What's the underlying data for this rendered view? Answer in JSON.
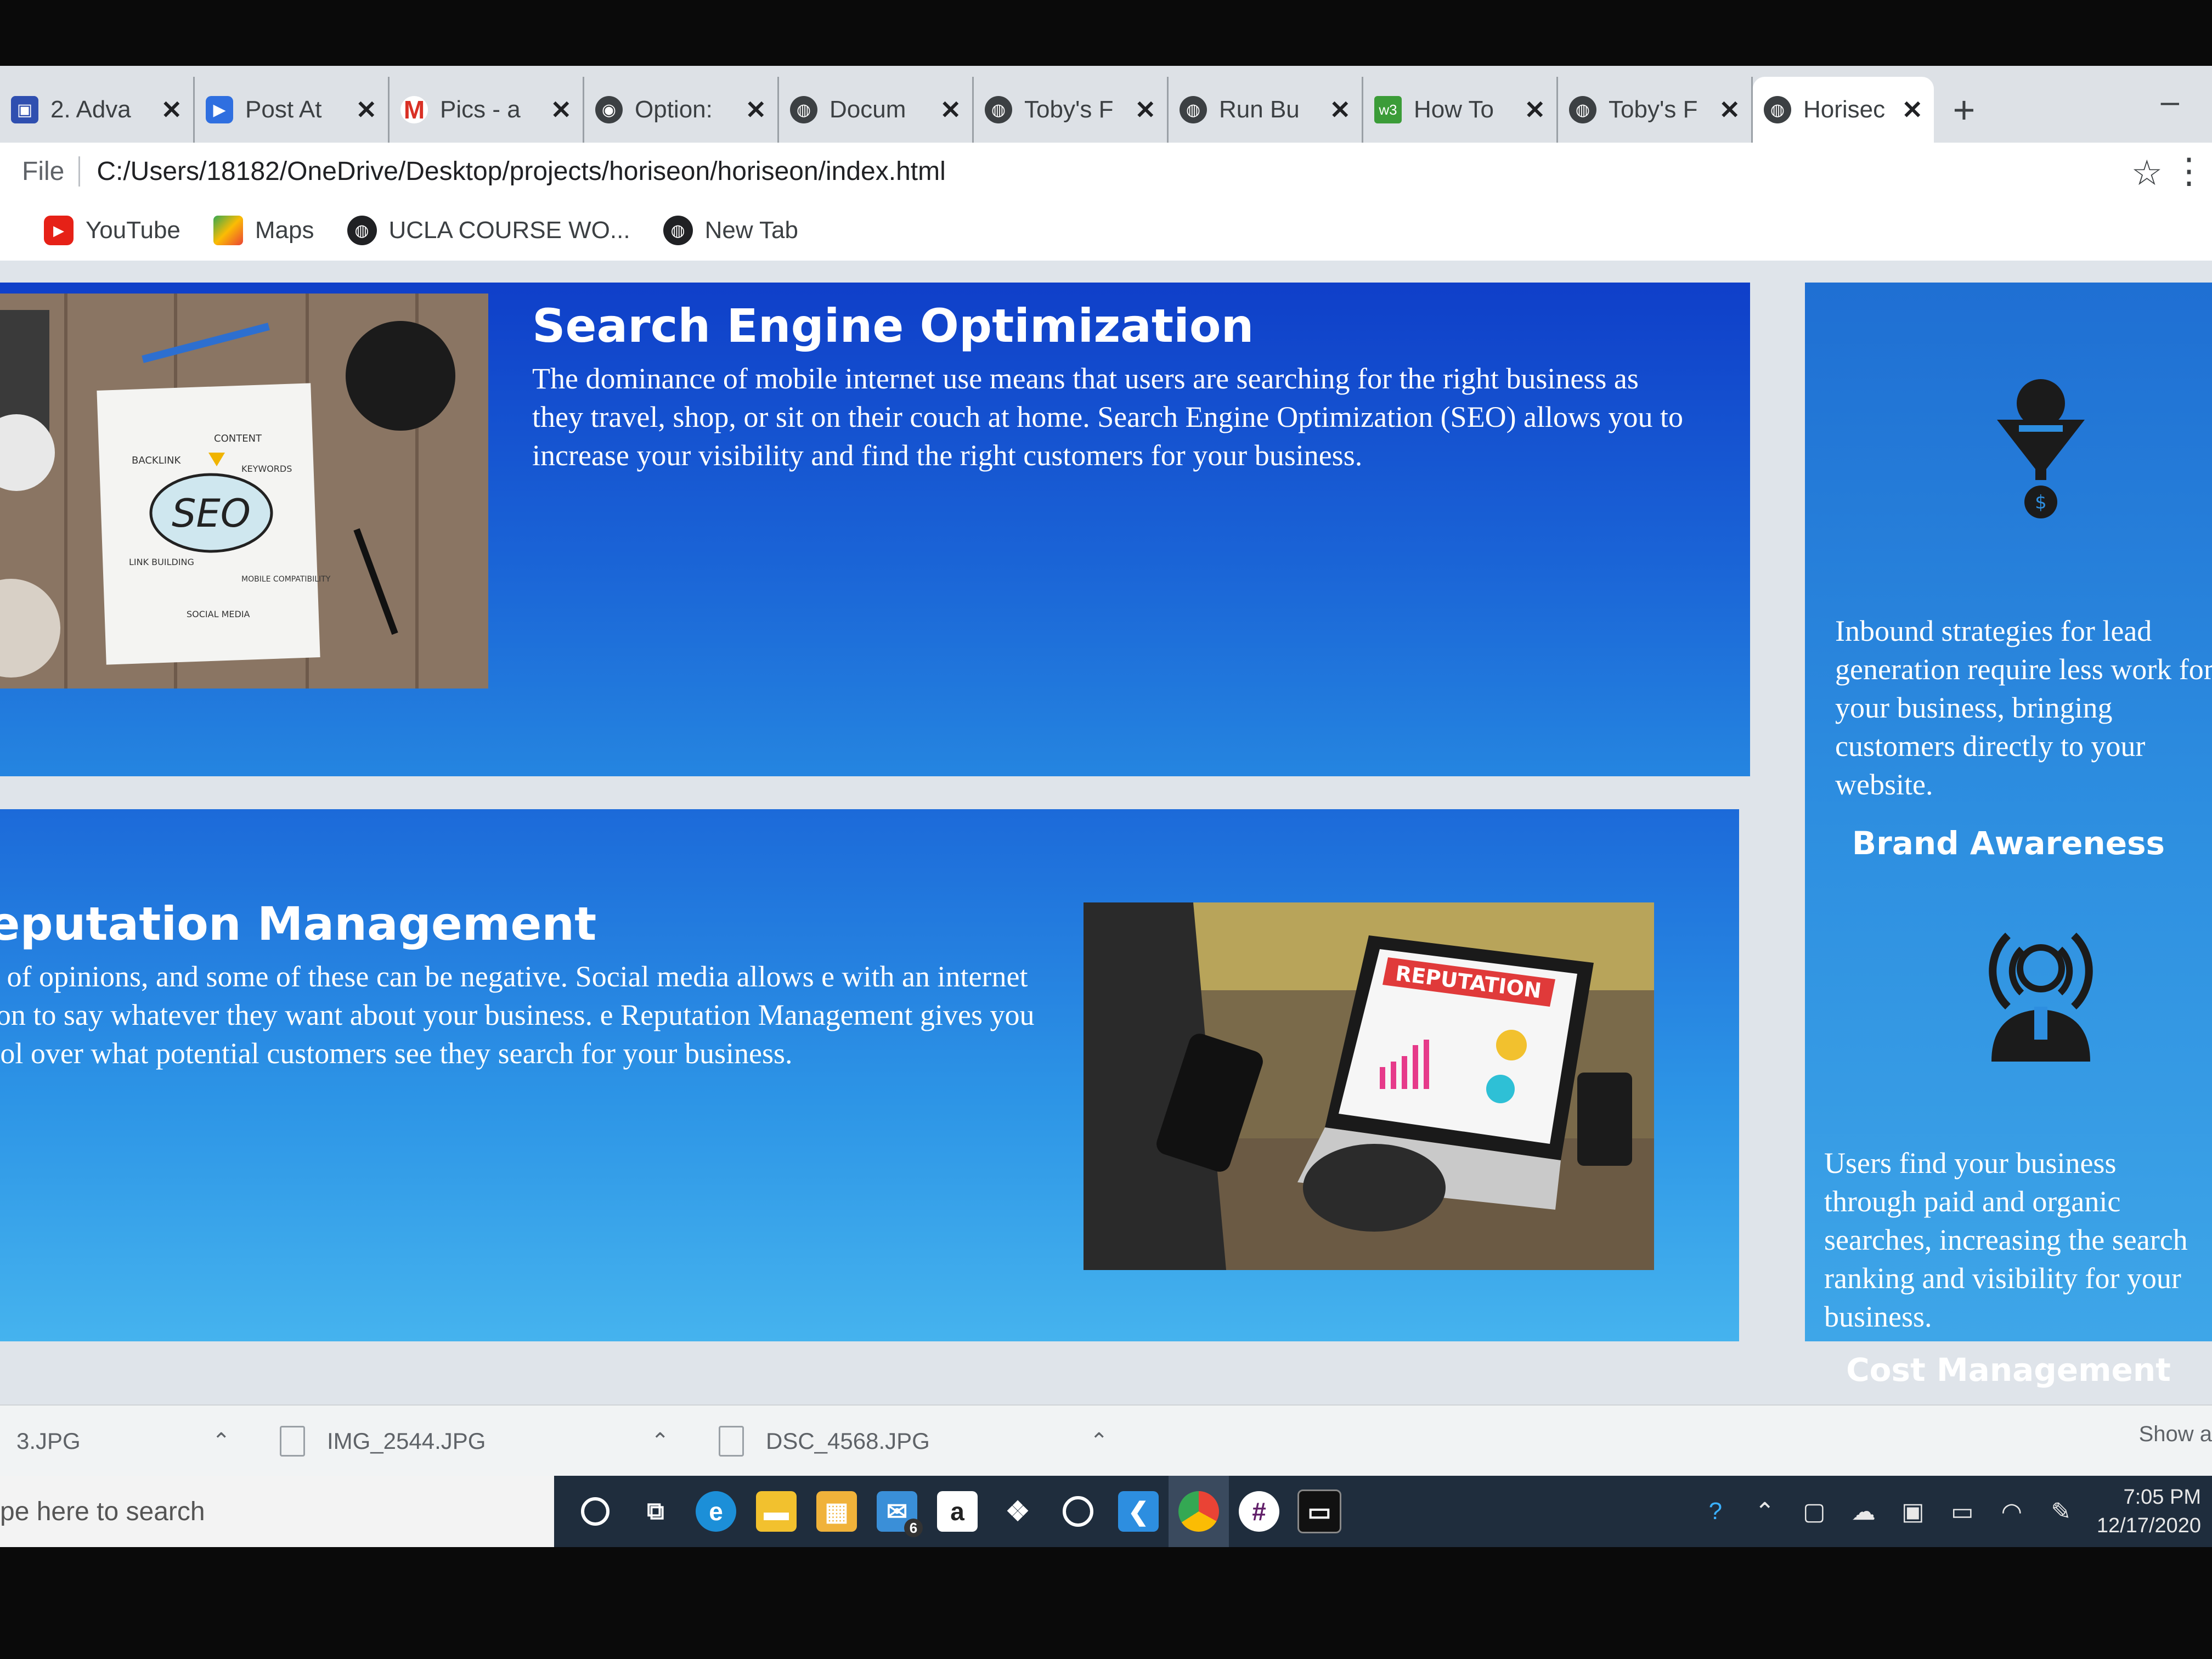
{
  "browser": {
    "tabs": [
      {
        "title": "2. Adva",
        "icon": "zoom-icon"
      },
      {
        "title": "Post At",
        "icon": "zoom-icon"
      },
      {
        "title": "Pics - a",
        "icon": "gmail-icon"
      },
      {
        "title": "Option:",
        "icon": "github-icon"
      },
      {
        "title": "Docum",
        "icon": "globe-icon"
      },
      {
        "title": "Toby's F",
        "icon": "globe-icon"
      },
      {
        "title": "Run Bu",
        "icon": "globe-icon"
      },
      {
        "title": "How To",
        "icon": "w3schools-icon"
      },
      {
        "title": "Toby's F",
        "icon": "globe-icon"
      },
      {
        "title": "Horisec",
        "icon": "globe-icon",
        "active": true
      }
    ],
    "new_tab": "+",
    "minimize": "–",
    "address": {
      "scheme_label": "File",
      "url": "C:/Users/18182/OneDrive/Desktop/projects/horiseon/horiseon/index.html"
    },
    "bookmarks": [
      {
        "label": "YouTube",
        "icon": "youtube-icon"
      },
      {
        "label": "Maps",
        "icon": "maps-icon"
      },
      {
        "label": "UCLA COURSE WO...",
        "icon": "globe-icon"
      },
      {
        "label": "New Tab",
        "icon": "globe-icon"
      }
    ]
  },
  "page": {
    "seo": {
      "title": "Search Engine Optimization",
      "text": "The dominance of mobile internet use means that users are searching for the right business as they travel, shop, or sit on their couch at home. Search Engine Optimization (SEO) allows you to increase your visibility and find the right customers for your business.",
      "image_words": [
        "SEO",
        "CONTENT",
        "BACKLINK",
        "KEYWORDS",
        "LINK BUILDING",
        "MOBILE COMPATIBILITY",
        "SOCIAL MEDIA"
      ]
    },
    "orm": {
      "title": "ine Reputation Management",
      "text": "eb is full of opinions, and some of these can be negative. Social media allows e with an internet connection to say whatever they want about your business. e Reputation Management gives you the control over what potential customers see they search for your business.",
      "image_words": [
        "REPUTATION"
      ]
    },
    "aside": {
      "lead_text": "Inbound strategies for lead generation require less work for your business, bringing customers directly to your website.",
      "brand_title": "Brand Awareness",
      "brand_text": "Users find your business through paid and organic searches, increasing the search ranking and visibility for your business.",
      "cost_title": "Cost Management"
    },
    "colors": {
      "primary": "#0f3fc9",
      "accent": "#2d95e6",
      "text": "#ffffff"
    }
  },
  "downloads": {
    "items": [
      "3.JPG",
      "IMG_2544.JPG",
      "DSC_4568.JPG"
    ],
    "show_all": "Show a"
  },
  "taskbar": {
    "search_placeholder": "pe here to search",
    "mail_badge": "6",
    "time": "7:05 PM",
    "date": "12/17/2020"
  }
}
